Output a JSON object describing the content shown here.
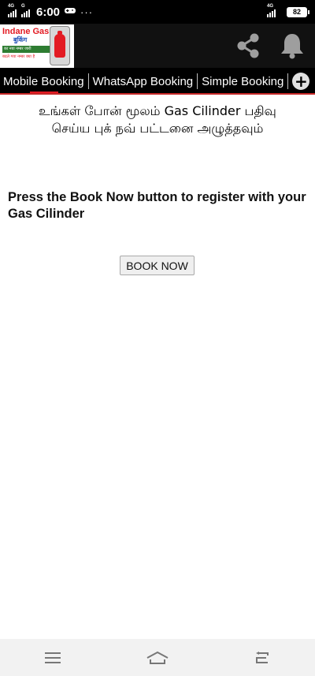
{
  "status_bar": {
    "time": "6:00",
    "signal1_tag": "4G",
    "signal2_tag": "G",
    "dots": "···",
    "network_right": "4G",
    "battery": "82"
  },
  "app_bar": {
    "logo": {
      "title": "Indane Gas",
      "subtitle": "बुकिंग",
      "band_text": "का नया नम्बर जारी",
      "band_text2": "बदले गया नम्बर क्या है"
    },
    "icons": [
      "share-icon",
      "bell-icon"
    ]
  },
  "tabs": [
    {
      "label": "Mobile Booking",
      "active": true
    },
    {
      "label": "WhatsApp Booking",
      "active": false
    },
    {
      "label": "Simple Booking",
      "active": false
    }
  ],
  "content": {
    "headline_line1": "உங்கள் போன் மூலம் Gas Cilinder பதிவு",
    "headline_line2": "செய்ய புக் நவ் பட்டனை அழுத்தவும்",
    "instruction": "Press the Book Now button to register with your Gas Cilinder",
    "book_button": "BOOK NOW"
  },
  "colors": {
    "accent": "#e31b23",
    "app_bar": "#111111",
    "status_bar": "#000000",
    "nav_bar": "#f2f2f2"
  }
}
